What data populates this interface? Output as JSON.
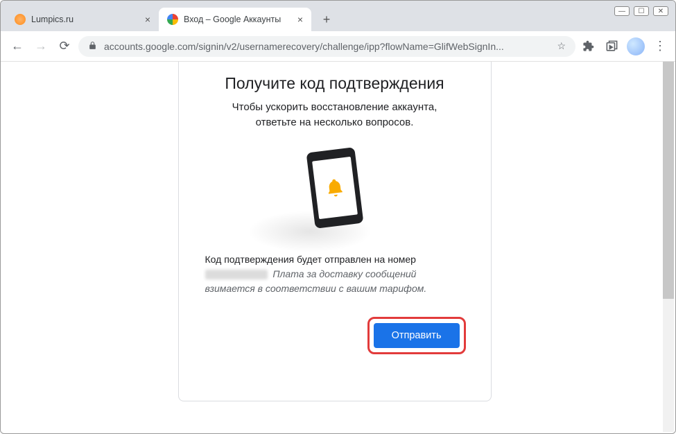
{
  "window": {
    "controls": {
      "min": "—",
      "max": "☐",
      "close": "✕"
    }
  },
  "tabs": [
    {
      "title": "Lumpics.ru",
      "active": false
    },
    {
      "title": "Вход – Google Аккаунты",
      "active": true
    }
  ],
  "newtab": "+",
  "addressbar": {
    "url": "accounts.google.com/signin/v2/usernamerecovery/challenge/ipp?flowName=GlifWebSignIn...",
    "star": "☆"
  },
  "content": {
    "heading": "Получите код подтверждения",
    "subtitle_line1": "Чтобы ускорить восстановление аккаунта,",
    "subtitle_line2": "ответьте на несколько вопросов.",
    "desc_line1": "Код подтверждения будет отправлен на номер",
    "desc_fee": "Плата за доставку сообщений взимается в соответствии с вашим тарифом.",
    "send_button": "Отправить"
  }
}
